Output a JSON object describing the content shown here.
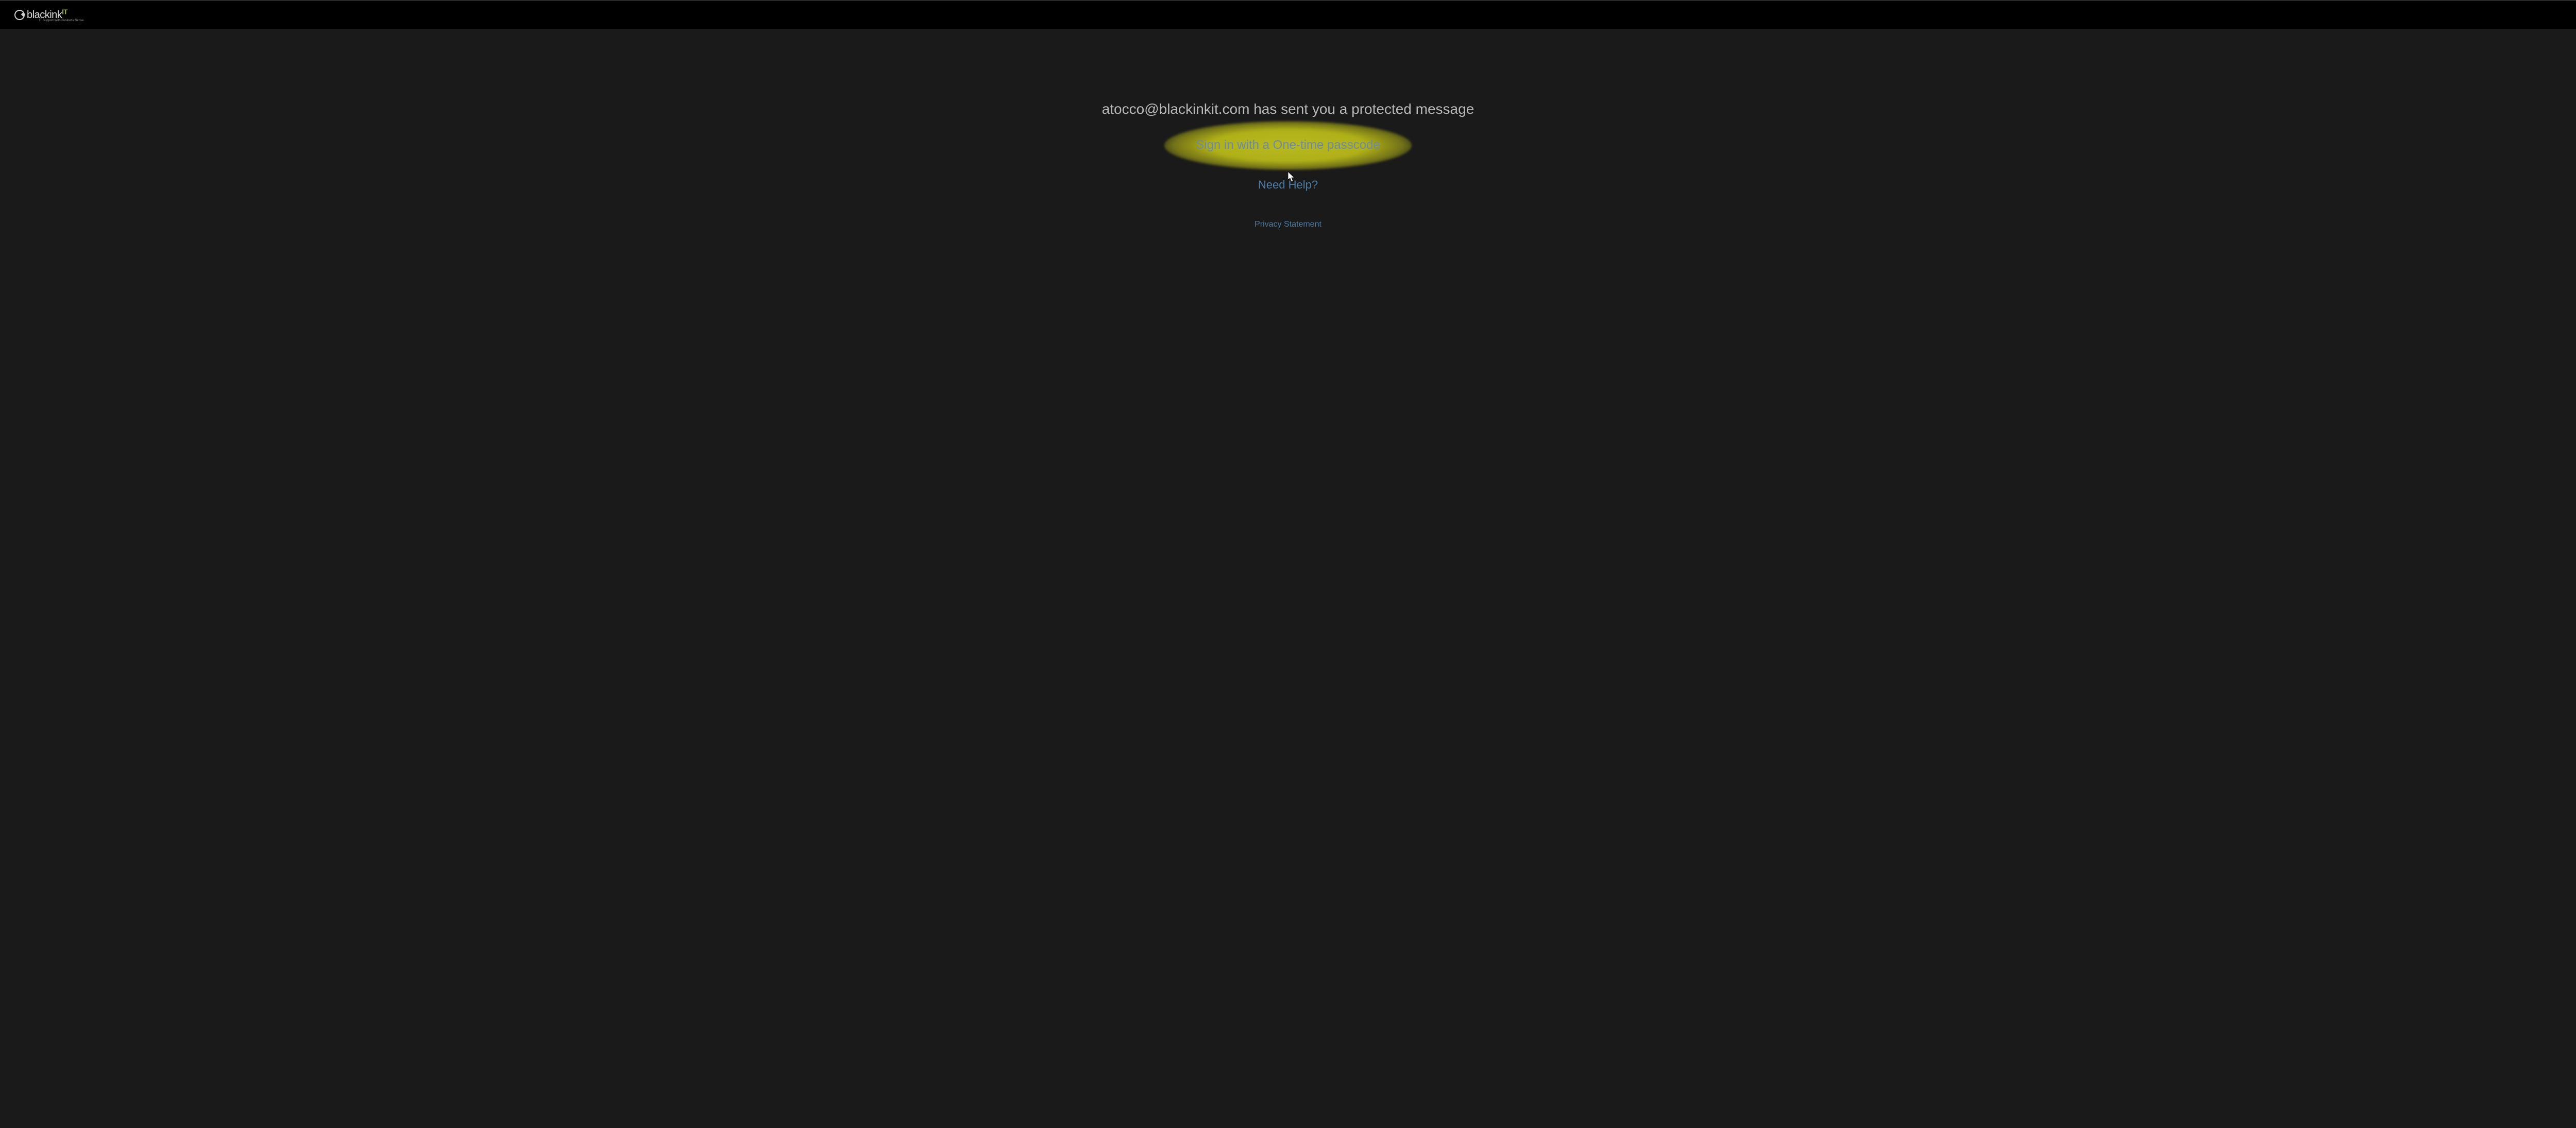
{
  "header": {
    "logo_main": "blackink",
    "logo_suffix": "IT",
    "logo_tagline": "IT Support With Business Sense."
  },
  "main": {
    "sender_message": "atocco@blackinkit.com has sent you a protected message",
    "signin_label": "Sign in with a One-time passcode",
    "help_label": "Need Help?",
    "privacy_label": "Privacy Statement"
  }
}
